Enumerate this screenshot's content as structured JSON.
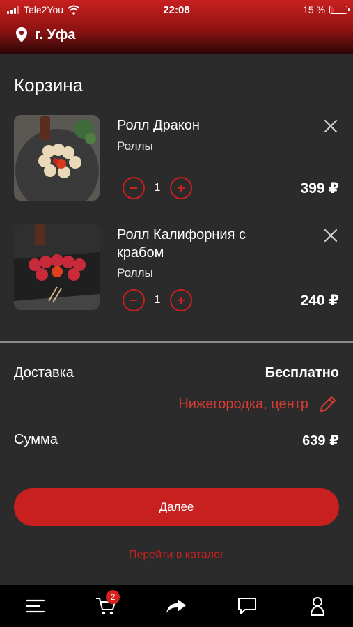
{
  "status_bar": {
    "carrier": "Tele2You",
    "time": "22:08",
    "battery": "15 %"
  },
  "header": {
    "city": "г. Уфа"
  },
  "page": {
    "title": "Корзина"
  },
  "cart": {
    "items": [
      {
        "name": "Ролл Дракон",
        "category": "Роллы",
        "quantity": "1",
        "price": "399 ₽"
      },
      {
        "name": "Ролл Калифорния с крабом",
        "category": "Роллы",
        "quantity": "1",
        "price": "240 ₽"
      }
    ]
  },
  "summary": {
    "delivery_label": "Доставка",
    "delivery_value": "Бесплатно",
    "address": "Нижегородка, центр",
    "total_label": "Сумма",
    "total_value": "639 ₽"
  },
  "actions": {
    "next_label": "Далее",
    "catalog_label": "Перейти в каталог"
  },
  "tabbar": {
    "items": [
      {
        "icon": "menu-icon"
      },
      {
        "icon": "cart-icon",
        "badge": "2"
      },
      {
        "icon": "share-icon"
      },
      {
        "icon": "chat-icon"
      },
      {
        "icon": "profile-icon"
      }
    ]
  },
  "colors": {
    "accent": "#c8201f",
    "background": "#2b2b2b",
    "address": "#d63b35"
  }
}
